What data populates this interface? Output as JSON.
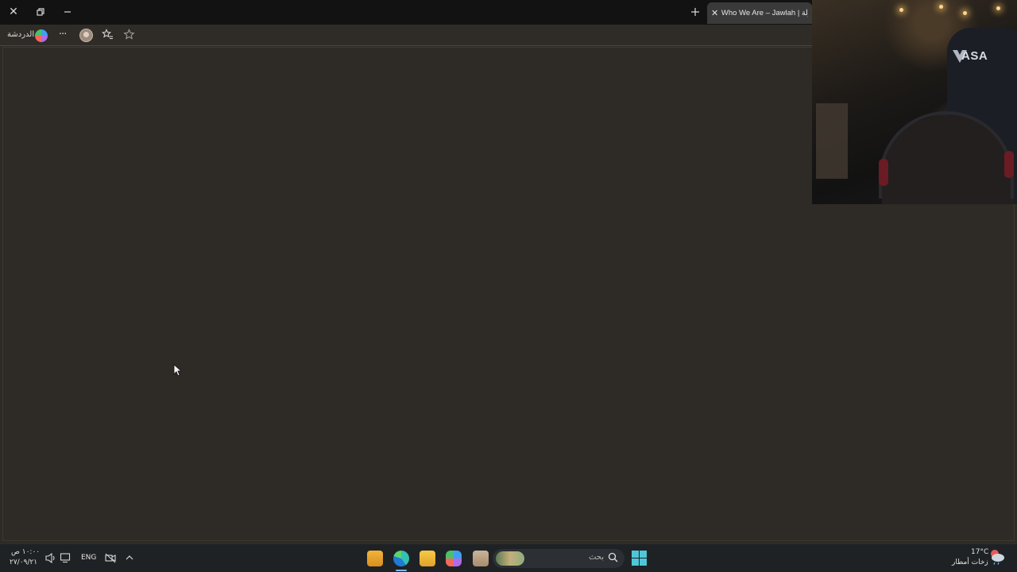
{
  "browser": {
    "window_controls": {
      "close": "✕",
      "restore": "⧉",
      "minimize": "—"
    },
    "new_tab": "+",
    "tab": {
      "close": "✕",
      "title": "Who We Are – Jawlah | جولة"
    },
    "toolbar": {
      "chat_label": "الدردشة",
      "more": "···"
    }
  },
  "webcam": {
    "brand": "ASA"
  },
  "taskbar": {
    "time": "١٠:٠٠ ص",
    "date": "٢٧/٠٩/٢١",
    "language": "ENG",
    "search_placeholder": "بحث",
    "weather_temp": "17°C",
    "weather_desc": "زخات أمطار"
  },
  "colors": {
    "content_bg": "#2e2b26",
    "titlebar_bg": "#121212",
    "taskbar_bg": "#1f2225"
  }
}
